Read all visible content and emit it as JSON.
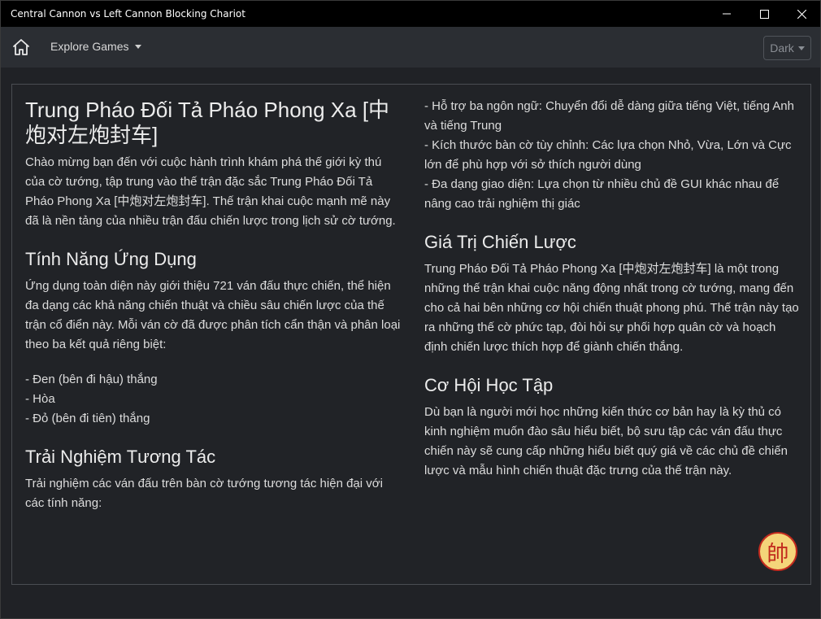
{
  "window": {
    "title": "Central Cannon vs Left Cannon Blocking Chariot"
  },
  "navbar": {
    "home_icon": "home-icon",
    "explore_label": "Explore Games",
    "theme_label": "Dark"
  },
  "content": {
    "title": "Trung Pháo Đối Tả Pháo Phong Xa [中炮对左炮封车]",
    "intro": "Chào mừng bạn đến với cuộc hành trình khám phá thế giới kỳ thú của cờ tướng, tập trung vào thế trận đặc sắc Trung Pháo Đối Tả Pháo Phong Xa [中炮对左炮封车]. Thế trận khai cuộc mạnh mẽ này đã là nền tảng của nhiều trận đấu chiến lược trong lịch sử cờ tướng.",
    "features_heading": "Tính Năng Ứng Dụng",
    "features_text": "Ứng dụng toàn diện này giới thiệu 721 ván đấu thực chiến, thể hiện đa dạng các khả năng chiến thuật và chiều sâu chiến lược của thế trận cổ điển này. Mỗi ván cờ đã được phân tích cẩn thận và phân loại theo ba kết quả riêng biệt:",
    "results": [
      "- Đen (bên đi hậu) thắng",
      "- Hòa",
      "- Đỏ (bên đi tiên) thắng"
    ],
    "interactive_heading": "Trải Nghiệm Tương Tác",
    "interactive_text": "Trải nghiệm các ván đấu trên bàn cờ tướng tương tác hiện đại với các tính năng:",
    "interactive_features": [
      "- Hỗ trợ ba ngôn ngữ: Chuyển đổi dễ dàng giữa tiếng Việt, tiếng Anh và tiếng Trung",
      "- Kích thước bàn cờ tùy chỉnh: Các lựa chọn Nhỏ, Vừa, Lớn và Cực lớn để phù hợp với sở thích người dùng",
      "- Đa dạng giao diện: Lựa chọn từ nhiều chủ đề GUI khác nhau để nâng cao trải nghiệm thị giác"
    ],
    "strategy_heading": "Giá Trị Chiến Lược",
    "strategy_text": "Trung Pháo Đối Tả Pháo Phong Xa [中炮对左炮封车] là một trong những thế trận khai cuộc năng động nhất trong cờ tướng, mang đến cho cả hai bên những cơ hội chiến thuật phong phú. Thế trận này tạo ra những thế cờ phức tạp, đòi hỏi sự phối hợp quân cờ và hoạch định chiến lược thích hợp để giành chiến thắng.",
    "learning_heading": "Cơ Hội Học Tập",
    "learning_text": "Dù bạn là người mới học những kiến thức cơ bản hay là kỳ thủ có kinh nghiệm muốn đào sâu hiểu biết, bộ sưu tập các ván đấu thực chiến này sẽ cung cấp những hiểu biết quý giá về các chủ đề chiến lược và mẫu hình chiến thuật đặc trưng của thế trận này."
  },
  "badge": {
    "glyph": "帥",
    "color": "#c22b1e",
    "background": "#f4d57a"
  }
}
